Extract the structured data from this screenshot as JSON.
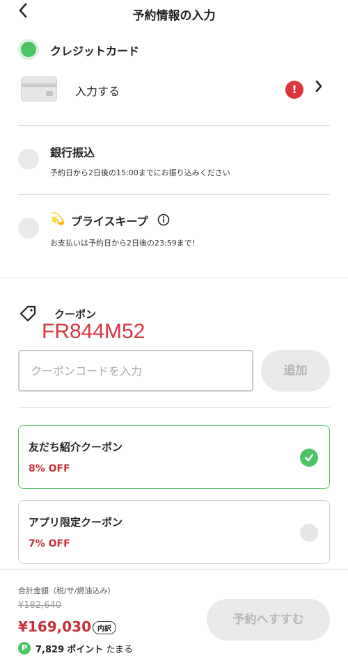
{
  "header": {
    "back_icon": "chevron-left-icon",
    "back_glyph": "‹",
    "title": "予約情報の入力"
  },
  "payment": {
    "credit": {
      "label": "クレジットカード",
      "entry_label": "入力する",
      "error_glyph": "!"
    },
    "bank": {
      "label": "銀行振込",
      "note": "予約日から2日後の15:00までにお振り込みください"
    },
    "keep": {
      "emoji": "💫",
      "label": "プライスキープ",
      "info_glyph": "i",
      "note": "お支払いは予約日から2日後の23:59まで！"
    }
  },
  "coupon": {
    "title": "クーポン",
    "overlay_code": "FR844M52",
    "input_placeholder": "クーポンコードを入力",
    "add_label": "追加",
    "items": [
      {
        "name": "友だち紹介クーポン",
        "discount": "8% OFF",
        "selected": true
      },
      {
        "name": "アプリ限定クーポン",
        "discount": "7% OFF",
        "selected": false
      }
    ]
  },
  "footer": {
    "total_label": "合計金額（税/サ/燃油込み）",
    "original_price": "¥182,640",
    "price": "¥169,030",
    "breakdown_label": "内訳",
    "point_badge": "P",
    "points_value": "7,829",
    "points_unit": "ポイント",
    "points_suffix": "たまる",
    "reserve_label": "予約へすすむ"
  },
  "colors": {
    "accent_green": "#4cc463",
    "error_red": "#d9363e",
    "price_red": "#c8313a"
  }
}
